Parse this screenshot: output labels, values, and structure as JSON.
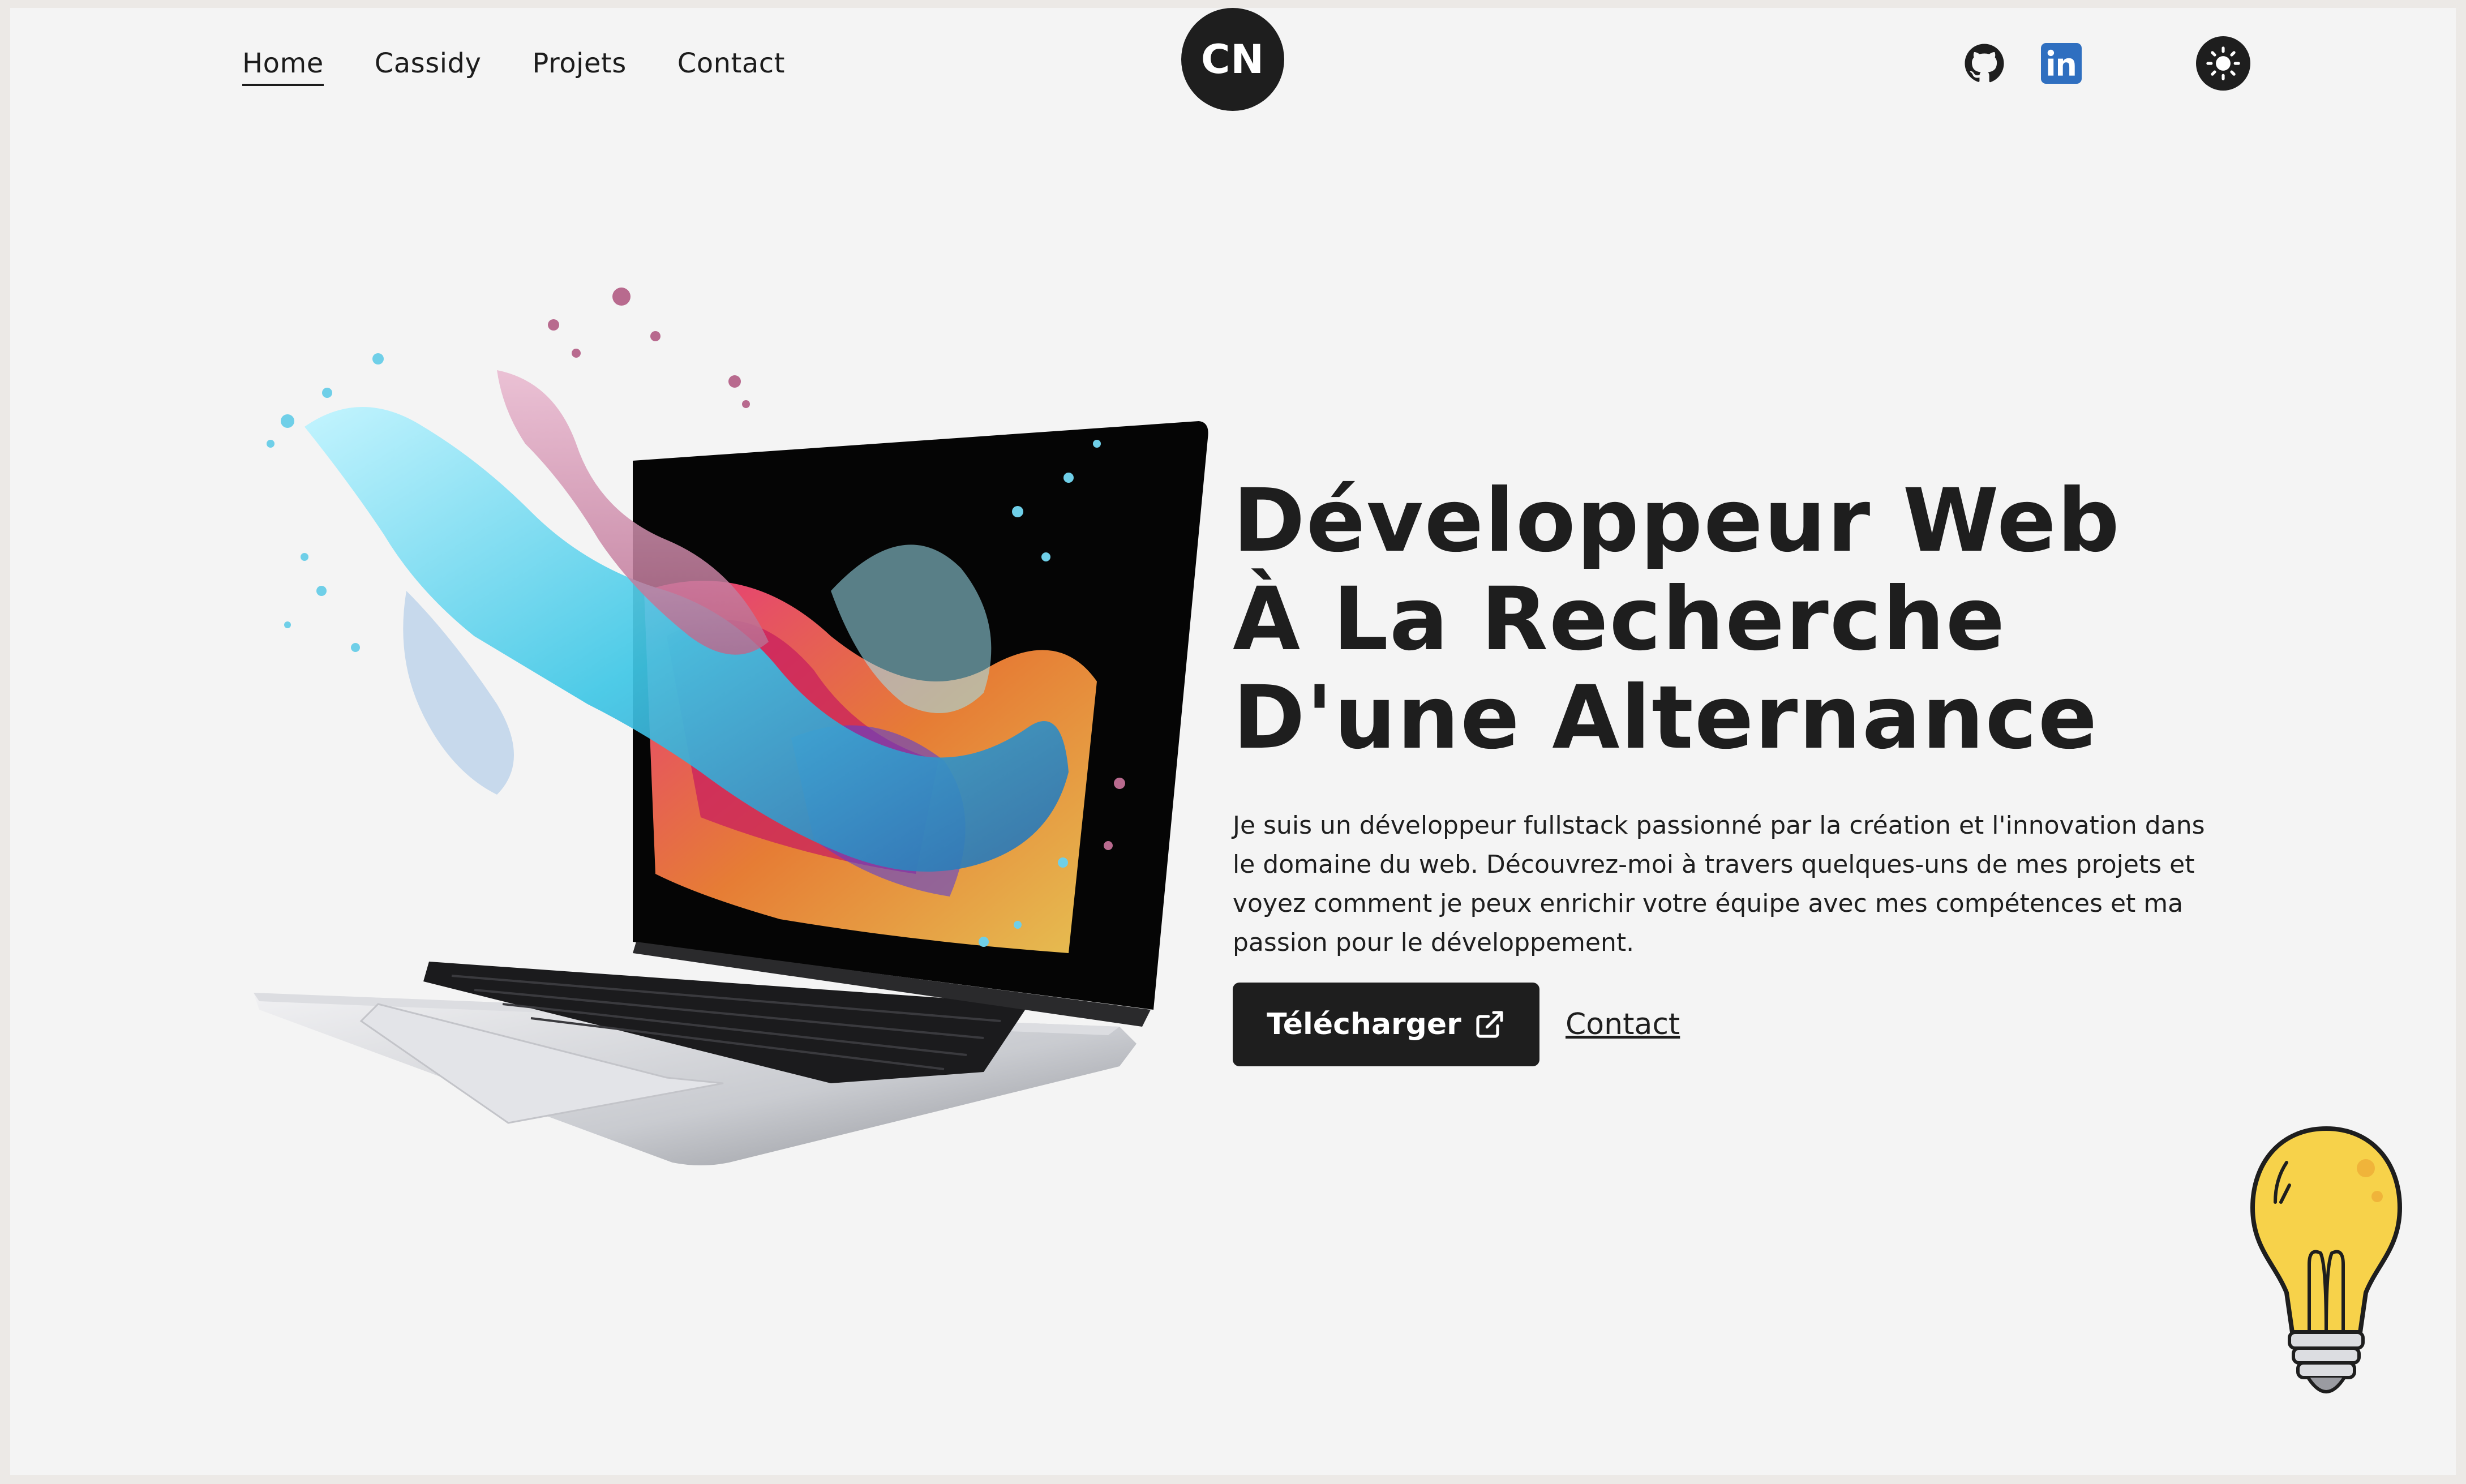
{
  "nav": {
    "links": [
      "Home",
      "Cassidy",
      "Projets",
      "Contact"
    ],
    "active": "Home",
    "logo_text": "CN"
  },
  "header_icons": {
    "github": "github-icon",
    "linkedin": "linkedin-icon",
    "theme": "sun-icon"
  },
  "hero": {
    "headline_lines": [
      "Développeur Web",
      "À La Recherche",
      "D'une Alternance"
    ],
    "intro": "Je suis un développeur fullstack passionné par la création et l'innovation dans le domaine du web. Découvrez-moi à travers quelques-uns de mes projets et voyez comment je peux enrichir votre équipe avec mes compétences et ma passion pour le développement.",
    "download_label": "Télécharger",
    "contact_label": "Contact",
    "image": "laptop-splash-image",
    "decoration": "lightbulb-icon"
  },
  "colors": {
    "background": "#f4f4f4",
    "dark": "#1e1e1e",
    "linkedin": "#2f6fc0",
    "bulb": "#f7d24a"
  }
}
